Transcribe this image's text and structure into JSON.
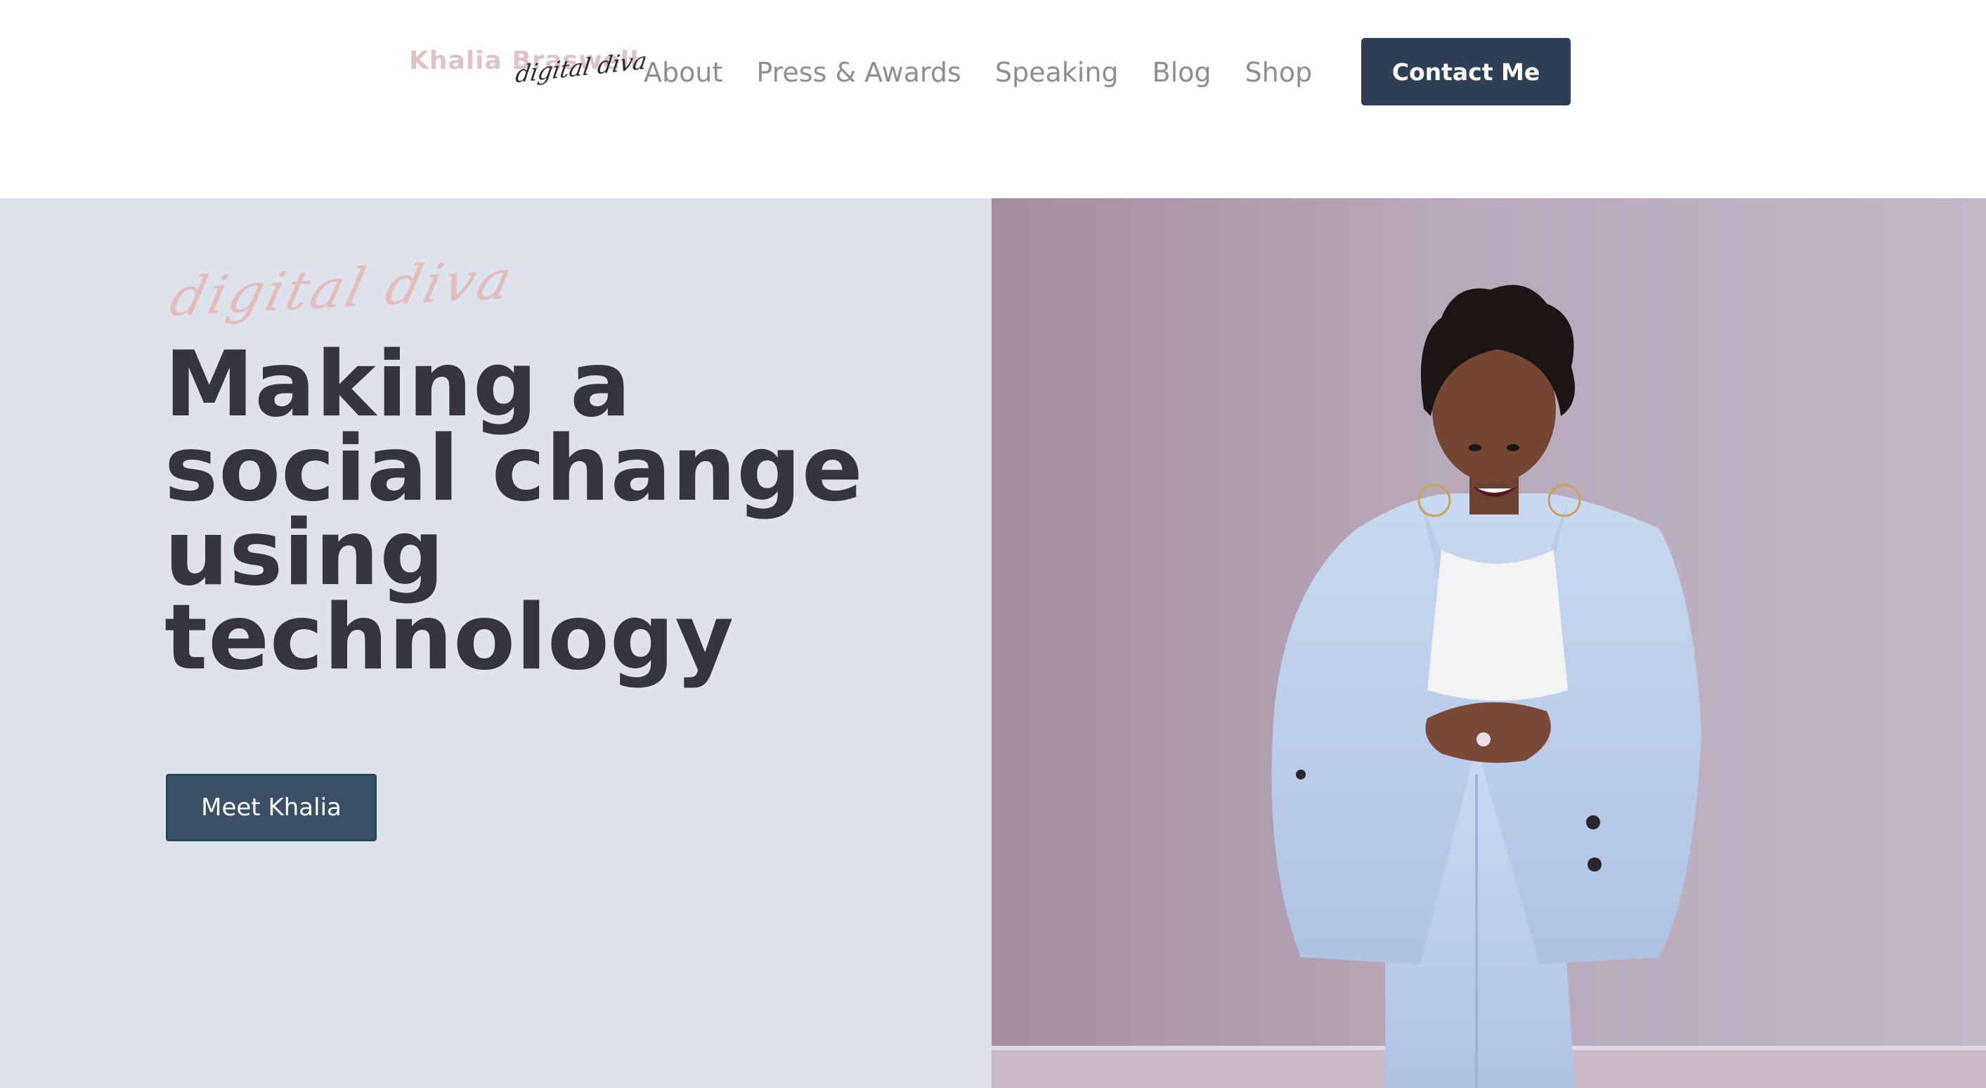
{
  "header": {
    "logo": {
      "name": "Khalia Braswell",
      "script": "digital diva"
    },
    "nav": [
      {
        "label": "About"
      },
      {
        "label": "Press & Awards"
      },
      {
        "label": "Speaking"
      },
      {
        "label": "Blog"
      },
      {
        "label": "Shop"
      }
    ],
    "contact_label": "Contact Me"
  },
  "hero": {
    "tagline": "digital diva",
    "headline_lines": [
      "Making a",
      "social change",
      "using",
      "technology"
    ],
    "cta_label": "Meet Khalia",
    "photo_alt": "Woman in a light blue pantsuit standing against a lilac wall"
  },
  "colors": {
    "brand_dark": "#2e3e53",
    "hero_bg": "#dde2ec",
    "headline": "#353541",
    "accent_pink": "#e0c3c4",
    "nav_text": "#8e8e8e"
  }
}
